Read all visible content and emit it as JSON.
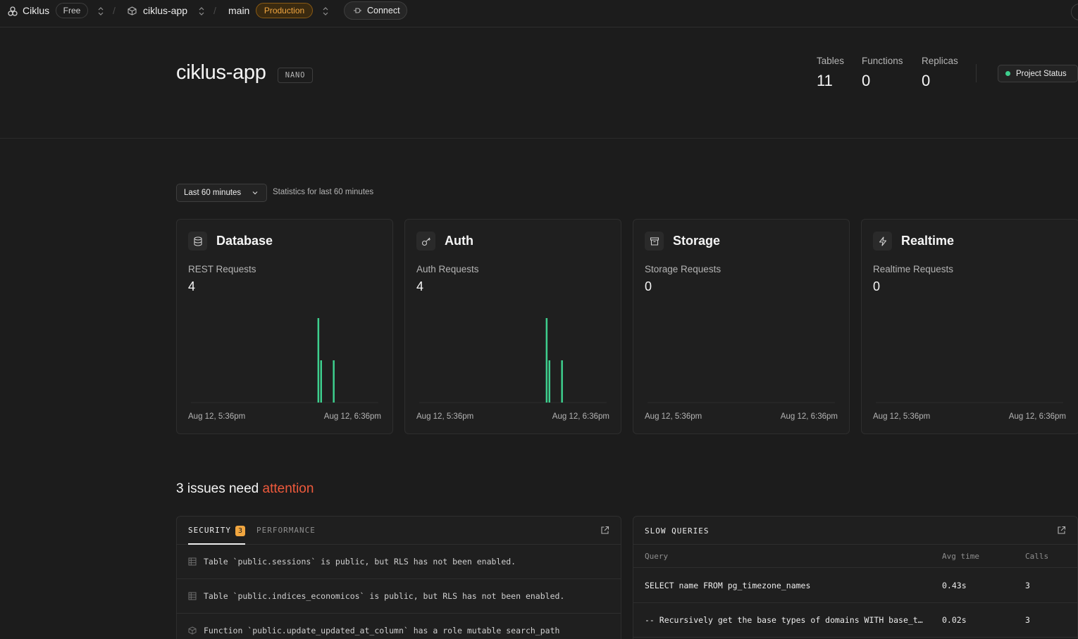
{
  "topbar": {
    "org_name": "Ciklus",
    "plan_badge": "Free",
    "project_name": "ciklus-app",
    "branch_name": "main",
    "env_badge": "Production",
    "connect_label": "Connect"
  },
  "header": {
    "project_title": "ciklus-app",
    "tier_badge": "NANO",
    "stats": [
      {
        "label": "Tables",
        "value": "11"
      },
      {
        "label": "Functions",
        "value": "0"
      },
      {
        "label": "Replicas",
        "value": "0"
      }
    ],
    "status_button": "Project Status"
  },
  "range": {
    "selected": "Last 60 minutes",
    "description": "Statistics for last 60 minutes"
  },
  "cards": [
    {
      "title": "Database",
      "icon": "database-icon",
      "metric_label": "REST Requests",
      "metric_value": "4",
      "axis_start": "Aug 12, 5:36pm",
      "axis_end": "Aug 12, 6:36pm",
      "bars": [
        {
          "t": 0.675,
          "v": 2
        },
        {
          "t": 0.69,
          "v": 1
        },
        {
          "t": 0.757,
          "v": 1
        }
      ]
    },
    {
      "title": "Auth",
      "icon": "key-icon",
      "metric_label": "Auth Requests",
      "metric_value": "4",
      "axis_start": "Aug 12, 5:36pm",
      "axis_end": "Aug 12, 6:36pm",
      "bars": [
        {
          "t": 0.675,
          "v": 2
        },
        {
          "t": 0.69,
          "v": 1
        },
        {
          "t": 0.757,
          "v": 1
        }
      ]
    },
    {
      "title": "Storage",
      "icon": "archive-icon",
      "metric_label": "Storage Requests",
      "metric_value": "0",
      "axis_start": "Aug 12, 5:36pm",
      "axis_end": "Aug 12, 6:36pm",
      "bars": []
    },
    {
      "title": "Realtime",
      "icon": "zap-icon",
      "metric_label": "Realtime Requests",
      "metric_value": "0",
      "axis_start": "Aug 12, 5:36pm",
      "axis_end": "Aug 12, 6:36pm",
      "bars": []
    }
  ],
  "chart_data": [
    {
      "type": "bar",
      "title": "REST Requests",
      "x_range": [
        "Aug 12, 5:36pm",
        "Aug 12, 6:36pm"
      ],
      "series": [
        {
          "values": [
            2,
            1,
            1
          ]
        }
      ],
      "color": "#3ecf8e"
    },
    {
      "type": "bar",
      "title": "Auth Requests",
      "x_range": [
        "Aug 12, 5:36pm",
        "Aug 12, 6:36pm"
      ],
      "series": [
        {
          "values": [
            2,
            1,
            1
          ]
        }
      ],
      "color": "#3ecf8e"
    },
    {
      "type": "bar",
      "title": "Storage Requests",
      "x_range": [
        "Aug 12, 5:36pm",
        "Aug 12, 6:36pm"
      ],
      "series": [
        {
          "values": []
        }
      ]
    },
    {
      "type": "bar",
      "title": "Realtime Requests",
      "x_range": [
        "Aug 12, 5:36pm",
        "Aug 12, 6:36pm"
      ],
      "series": [
        {
          "values": []
        }
      ]
    }
  ],
  "issues": {
    "title_prefix": "3 issues need",
    "title_accent": "attention",
    "tabs": {
      "security": "SECURITY",
      "security_count": "3",
      "performance": "PERFORMANCE"
    },
    "rows": [
      {
        "icon": "table-icon",
        "text": "Table `public.sessions` is public, but RLS has not been enabled."
      },
      {
        "icon": "table-icon",
        "text": "Table `public.indices_economicos` is public, but RLS has not been enabled."
      },
      {
        "icon": "function-icon",
        "text": "Function `public.update_updated_at_column` has a role mutable search_path"
      }
    ]
  },
  "slow_queries": {
    "title": "SLOW QUERIES",
    "columns": {
      "query": "Query",
      "avg": "Avg time",
      "calls": "Calls"
    },
    "rows": [
      {
        "query": "SELECT name FROM pg_timezone_names",
        "avg": "0.43s",
        "calls": "3"
      },
      {
        "query": "-- Recursively get the base types of domains WITH base_types AS (",
        "avg": "0.02s",
        "calls": "3"
      }
    ]
  },
  "colors": {
    "background": "#1c1c1c",
    "accent_green": "#3ecf8e",
    "warning_amber": "#f1a640",
    "attention_red": "#ef5a3c"
  }
}
